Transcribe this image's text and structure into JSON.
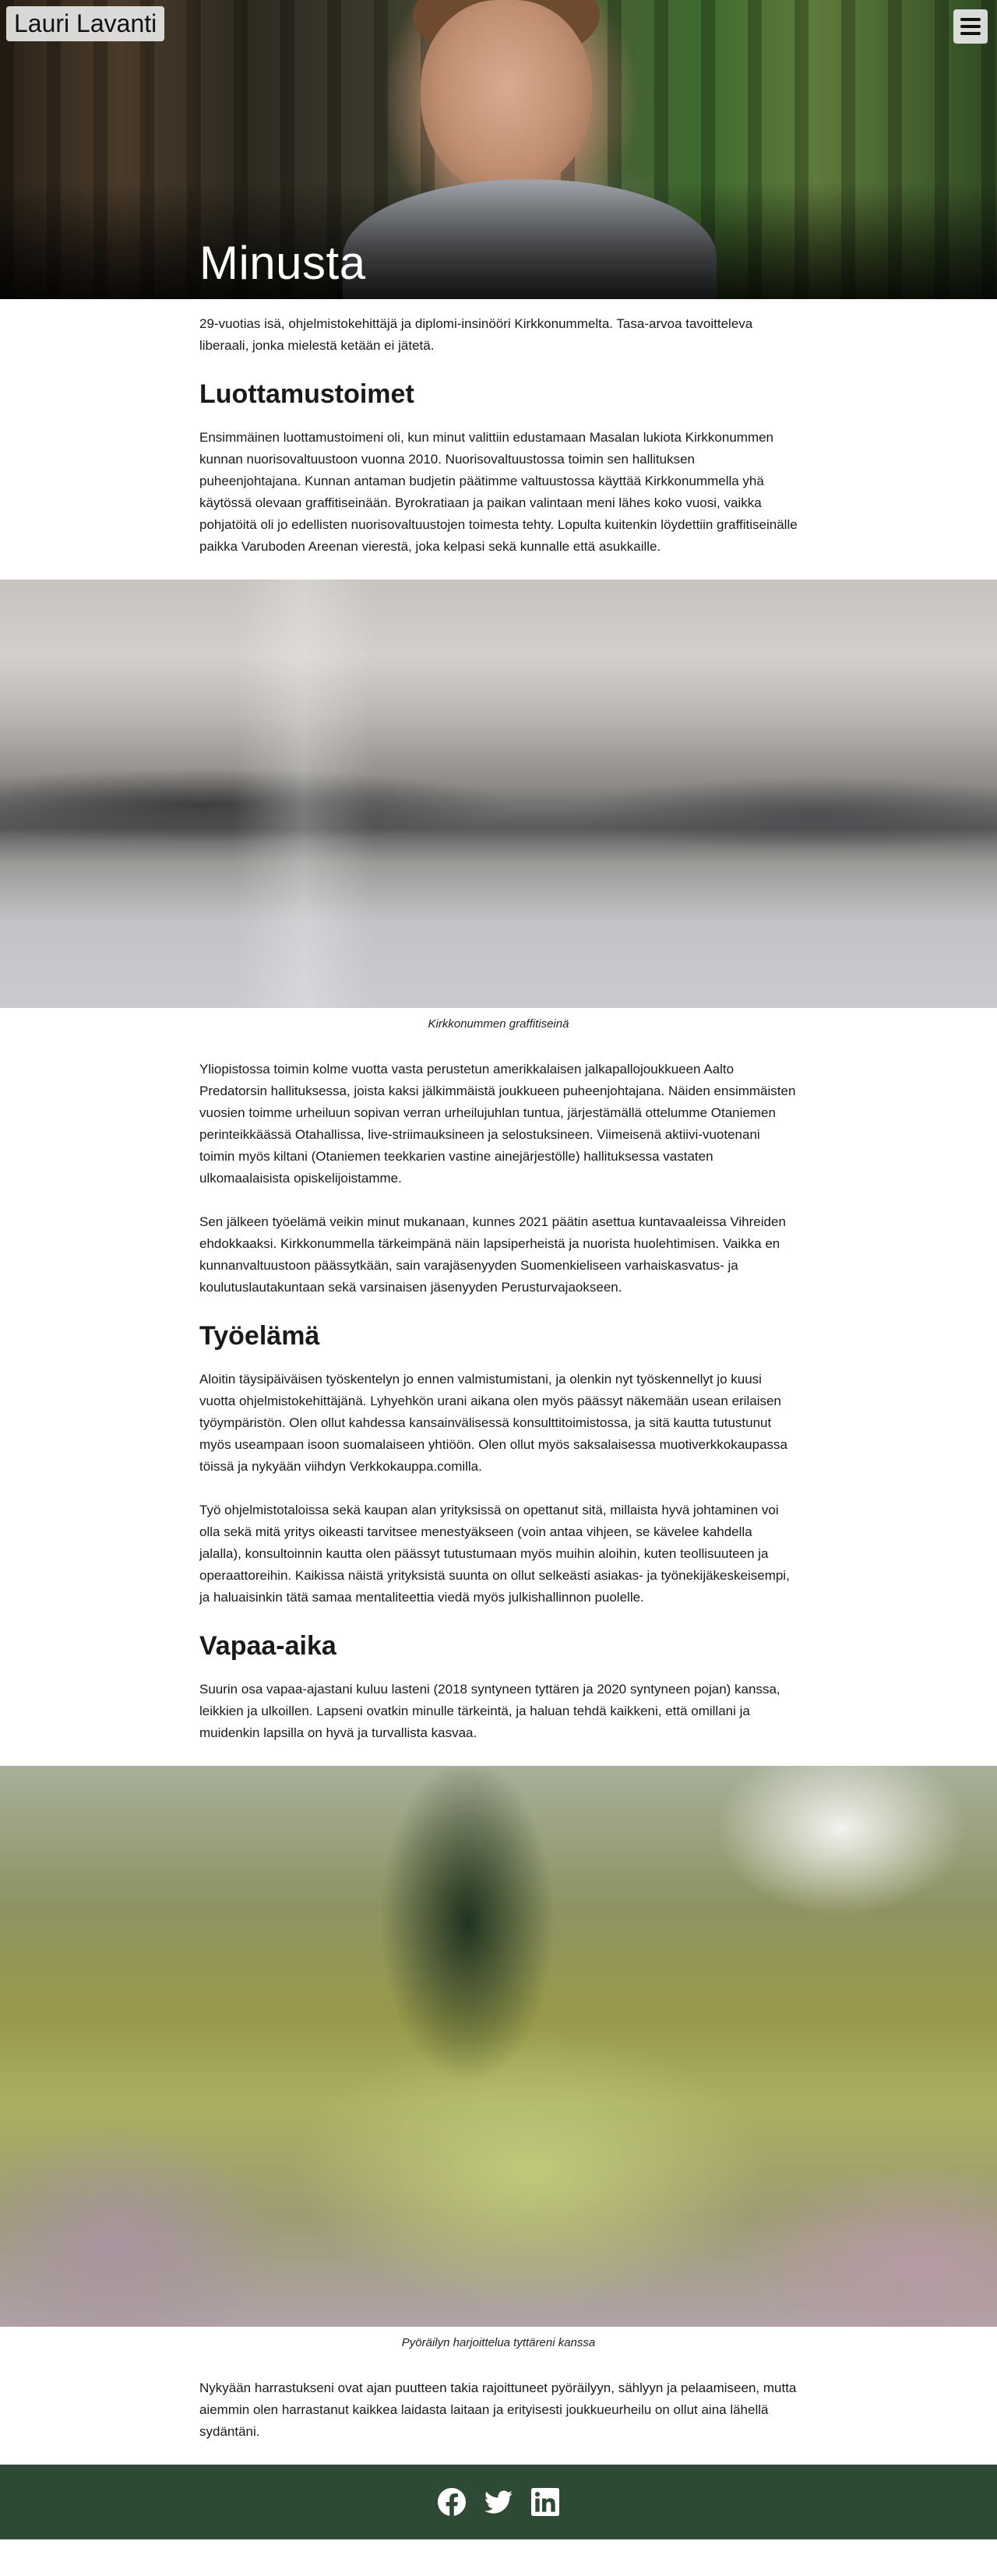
{
  "site": {
    "title": "Lauri Lavanti"
  },
  "hero": {
    "heading": "Minusta"
  },
  "intro": "29-vuotias isä, ohjelmistokehittäjä ja diplomi-insinööri Kirkkonummelta. Tasa-arvoa tavoitteleva liberaali, jonka mielestä ketään ei jätetä.",
  "sections": {
    "luottamus": {
      "heading": "Luottamustoimet",
      "p1": "Ensimmäinen luottamustoimeni oli, kun minut valittiin edustamaan Masalan lukiota Kirkkonummen kunnan nuorisovaltuustoon vuonna 2010. Nuorisovaltuustossa toimin sen hallituksen puheenjohtajana. Kunnan antaman budjetin päätimme valtuustossa käyttää Kirkkonummella yhä käytössä olevaan graffitiseinään. Byrokratiaan ja paikan valintaan meni lähes koko vuosi, vaikka pohjatöitä oli jo edellisten nuorisovaltuustojen toimesta tehty. Lopulta kuitenkin löydettiin graffitiseinälle paikka Varuboden Areenan vierestä, joka kelpasi sekä kunnalle että asukkaille.",
      "caption": "Kirkkonummen graffitiseinä",
      "p2": "Yliopistossa toimin kolme vuotta vasta perustetun amerikkalaisen jalkapallojoukkueen Aalto Predatorsin hallituksessa, joista kaksi jälkimmäistä joukkueen puheenjohtajana. Näiden ensimmäisten vuosien toimme urheiluun sopivan verran urheilujuhlan tuntua, järjestämällä ottelumme Otaniemen perinteikkäässä Otahallissa, live-striimauksineen ja selostuksineen. Viimeisenä aktiivi-vuotenani toimin myös kiltani (Otaniemen teekkarien vastine ainejärjestölle) hallituksessa vastaten ulkomaalaisista opiskelijoistamme.",
      "p3": "Sen jälkeen työelämä veikin minut mukanaan, kunnes 2021 päätin asettua kuntavaaleissa Vihreiden ehdokkaaksi. Kirkkonummella tärkeimpänä näin lapsiperheistä ja nuorista huolehtimisen. Vaikka en kunnanvaltuustoon päässytkään, sain varajäsenyyden Suomenkieliseen varhaiskasvatus- ja koulutuslautakuntaan sekä varsinaisen jäsenyyden Perusturvajaokseen."
    },
    "tyoelama": {
      "heading": "Työelämä",
      "p1": "Aloitin täysipäiväisen työskentelyn jo ennen valmistumistani, ja olenkin nyt työskennellyt jo kuusi vuotta ohjelmistokehittäjänä. Lyhyehkön urani aikana olen myös päässyt näkemään usean erilaisen työympäristön. Olen ollut kahdessa kansainvälisessä konsulttitoimistossa, ja sitä kautta tutustunut myös useampaan isoon suomalaiseen yhtiöön. Olen ollut myös saksalaisessa muotiverkkokaupassa töissä ja nykyään viihdyn Verkkokauppa.comilla.",
      "p2": "Työ ohjelmistotaloissa sekä kaupan alan yrityksissä on opettanut sitä, millaista hyvä johtaminen voi olla sekä mitä yritys oikeasti tarvitsee menestyäkseen (voin antaa vihjeen, se kävelee kahdella jalalla), konsultoinnin kautta olen päässyt tutustumaan myös muihin aloihin, kuten teollisuuteen ja operaattoreihin. Kaikissa näistä yrityksistä suunta on ollut selkeästi asiakas- ja työnekijäkeskeisempi, ja haluaisinkin tätä samaa mentaliteettia viedä myös julkishallinnon puolelle."
    },
    "vapaa": {
      "heading": "Vapaa-aika",
      "p1": "Suurin osa vapaa-ajastani kuluu lasteni (2018 syntyneen tyttären ja 2020 syntyneen pojan) kanssa, leikkien ja ulkoillen. Lapseni ovatkin minulle tärkeintä, ja haluan tehdä kaikkeni, että omillani ja muidenkin lapsilla on hyvä ja turvallista kasvaa.",
      "caption": "Pyöräilyn harjoittelua tyttäreni kanssa",
      "p2": "Nykyään harrastukseni ovat ajan puutteen takia rajoittuneet pyöräilyyn, sählyyn ja pelaamiseen, mutta aiemmin olen harrastanut kaikkea laidasta laitaan ja erityisesti joukkueurheilu on ollut aina lähellä sydäntäni."
    }
  },
  "footer": {
    "social_icons": [
      "facebook-icon",
      "twitter-icon",
      "linkedin-icon"
    ],
    "background": "#2f4a34"
  }
}
